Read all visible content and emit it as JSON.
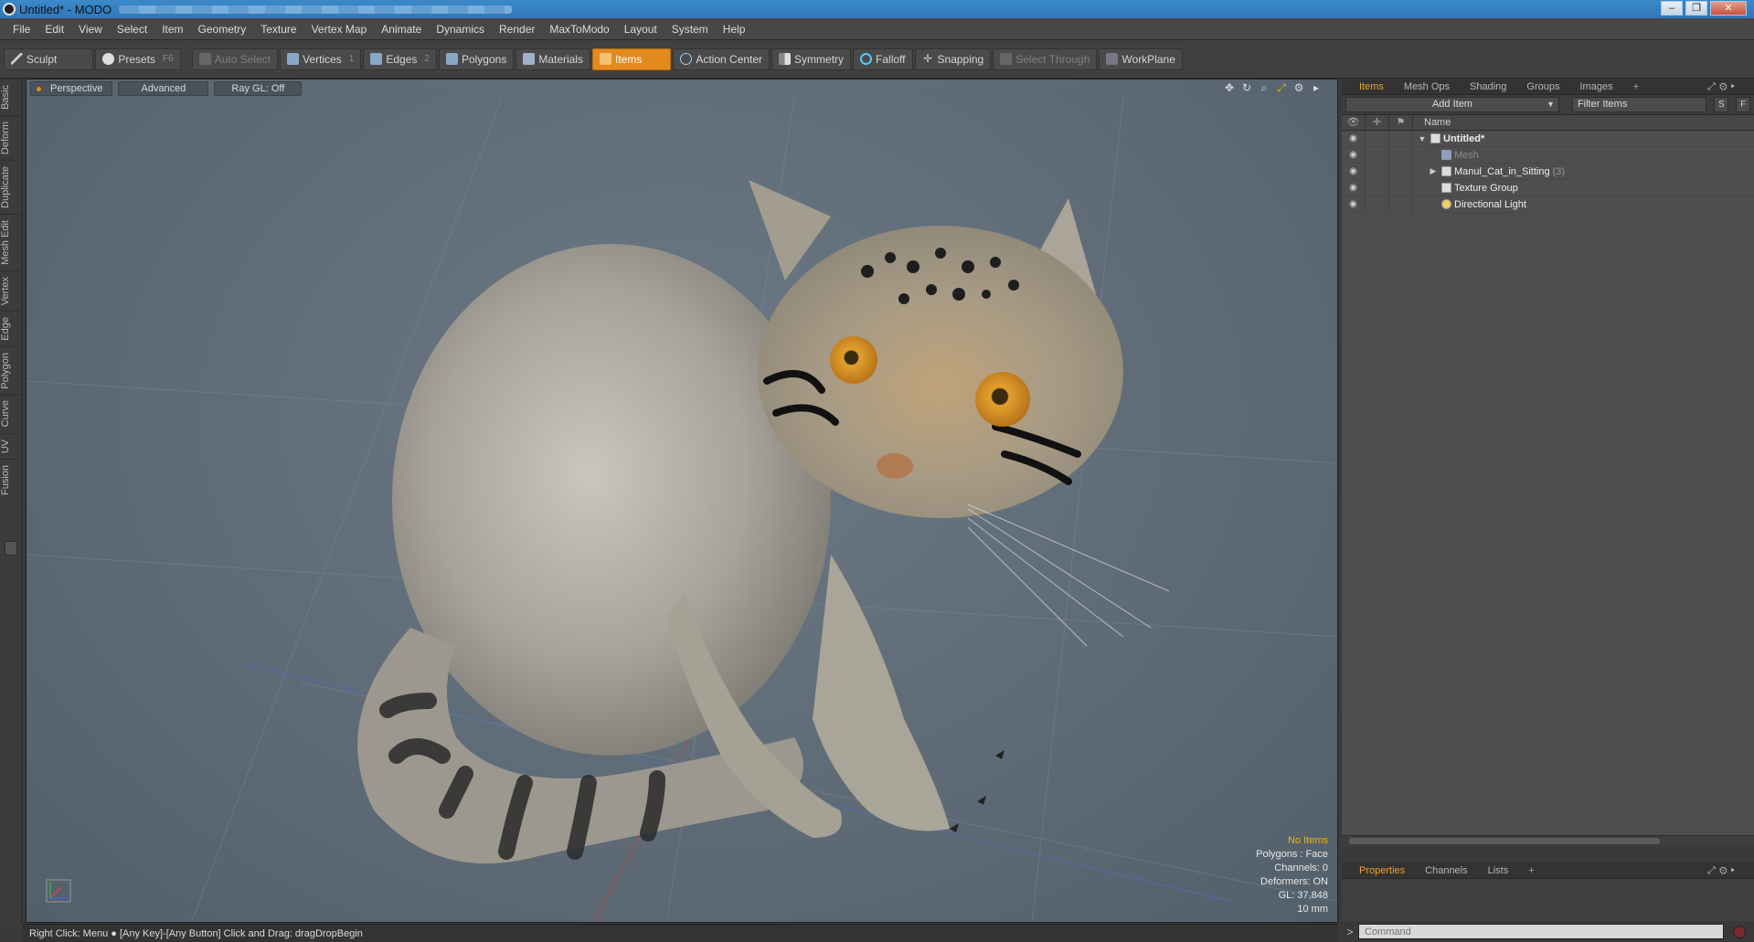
{
  "window": {
    "title": "Untitled* - MODO"
  },
  "menu": [
    "File",
    "Edit",
    "View",
    "Select",
    "Item",
    "Geometry",
    "Texture",
    "Vertex Map",
    "Animate",
    "Dynamics",
    "Render",
    "MaxToModo",
    "Layout",
    "System",
    "Help"
  ],
  "toolbar": {
    "sculpt": "Sculpt",
    "presets": "Presets",
    "presets_key": "F6",
    "auto_select": "Auto Select",
    "vertices": "Vertices",
    "vertices_key": "1",
    "edges": "Edges",
    "edges_key": "2",
    "polygons": "Polygons",
    "materials": "Materials",
    "items": "Items",
    "action_center": "Action Center",
    "symmetry": "Symmetry",
    "falloff": "Falloff",
    "snapping": "Snapping",
    "select_through": "Select Through",
    "workplane": "WorkPlane"
  },
  "side_tabs": [
    "Basic",
    "Deform",
    "Duplicate",
    "Mesh Edit",
    "Vertex",
    "Edge",
    "Polygon",
    "Curve",
    "UV",
    "Fusion"
  ],
  "viewport": {
    "view": "Perspective",
    "shading": "Advanced",
    "raygl": "Ray GL: Off",
    "stats": {
      "items": "No Items",
      "polygons": "Polygons : Face",
      "channels": "Channels: 0",
      "deformers": "Deformers: ON",
      "gl": "GL: 37,848",
      "scale": "10 mm"
    }
  },
  "items_panel": {
    "tabs": [
      "Items",
      "Mesh Ops",
      "Shading",
      "Groups",
      "Images"
    ],
    "add_item": "Add Item",
    "filter_placeholder": "Filter Items",
    "s": "S",
    "f": "F",
    "col_name": "Name",
    "tree": {
      "root": "Untitled*",
      "mesh": "Mesh",
      "cat": "Manul_Cat_in_Sitting",
      "cat_count": "(3)",
      "texture": "Texture Group",
      "light": "Directional Light"
    }
  },
  "props_panel": {
    "tabs": [
      "Properties",
      "Channels",
      "Lists"
    ]
  },
  "command": {
    "placeholder": "Command"
  },
  "statusbar": {
    "text": "Right Click: Menu ● [Any Key]-[Any Button] Click and Drag: dragDropBegin"
  },
  "colors": {
    "accent": "#e38a1e",
    "viewport": "#5f6b76",
    "panel": "#3a3a3a"
  }
}
